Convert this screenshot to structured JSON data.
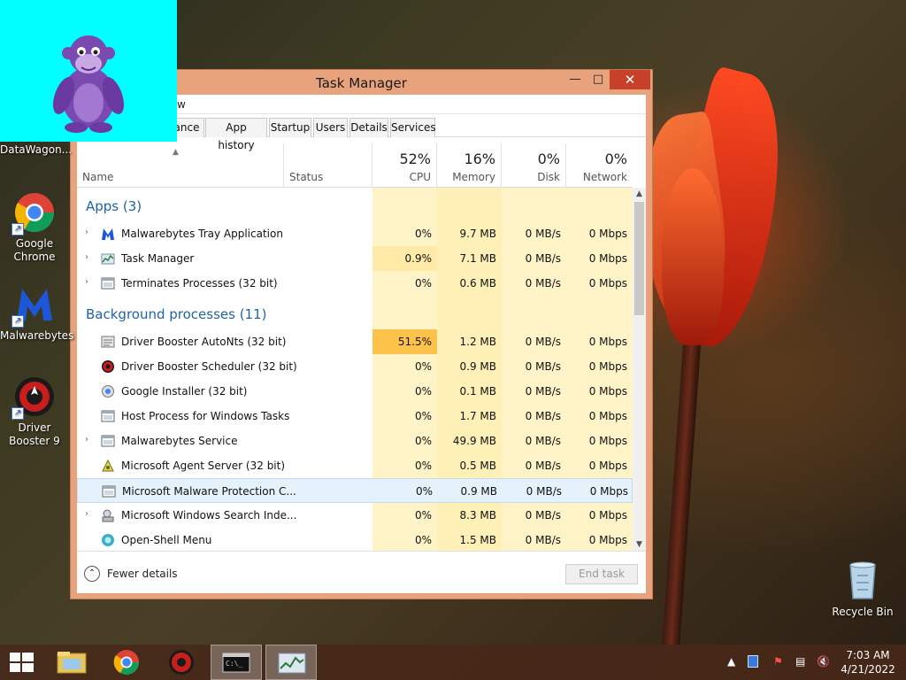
{
  "desktop": {
    "icons": [
      {
        "label": "DataWagon...",
        "icon": "bonzi-icon"
      },
      {
        "label": "Google Chrome",
        "icon": "chrome-icon"
      },
      {
        "label": "Malwarebytes",
        "icon": "malwarebytes-icon"
      },
      {
        "label": "Driver Booster 9",
        "icon": "driver-booster-icon"
      },
      {
        "label": "Recycle Bin",
        "icon": "recycle-bin-icon"
      }
    ]
  },
  "tm": {
    "title": "Task Manager",
    "tabs": [
      "ance",
      "App history",
      "Startup",
      "Users",
      "Details",
      "Services"
    ],
    "columns": {
      "name": "Name",
      "status": "Status",
      "cpu": {
        "pct": "52%",
        "label": "CPU"
      },
      "memory": {
        "pct": "16%",
        "label": "Memory"
      },
      "disk": {
        "pct": "0%",
        "label": "Disk"
      },
      "network": {
        "pct": "0%",
        "label": "Network"
      }
    },
    "groups": [
      "Apps (3)",
      "Background processes (11)"
    ],
    "rows": [
      {
        "name": "Malwarebytes Tray Application",
        "cpu": "0%",
        "memory": "9.7 MB",
        "disk": "0 MB/s",
        "network": "0 Mbps",
        "icon": "malwarebytes-icon",
        "expand": true
      },
      {
        "name": "Task Manager",
        "cpu": "0.9%",
        "memory": "7.1 MB",
        "disk": "0 MB/s",
        "network": "0 Mbps",
        "icon": "task-manager-icon",
        "expand": true
      },
      {
        "name": "Terminates Processes (32 bit)",
        "cpu": "0%",
        "memory": "0.6 MB",
        "disk": "0 MB/s",
        "network": "0 Mbps",
        "icon": "window-icon",
        "expand": true
      },
      {
        "name": "Driver Booster AutoNts (32 bit)",
        "cpu": "51.5%",
        "memory": "1.2 MB",
        "disk": "0 MB/s",
        "network": "0 Mbps",
        "icon": "service-icon",
        "expand": false
      },
      {
        "name": "Driver Booster Scheduler (32 bit)",
        "cpu": "0%",
        "memory": "0.9 MB",
        "disk": "0 MB/s",
        "network": "0 Mbps",
        "icon": "driver-booster-icon",
        "expand": false
      },
      {
        "name": "Google Installer (32 bit)",
        "cpu": "0%",
        "memory": "0.1 MB",
        "disk": "0 MB/s",
        "network": "0 Mbps",
        "icon": "installer-icon",
        "expand": false
      },
      {
        "name": "Host Process for Windows Tasks",
        "cpu": "0%",
        "memory": "1.7 MB",
        "disk": "0 MB/s",
        "network": "0 Mbps",
        "icon": "window-icon",
        "expand": false
      },
      {
        "name": "Malwarebytes Service",
        "cpu": "0%",
        "memory": "49.9 MB",
        "disk": "0 MB/s",
        "network": "0 Mbps",
        "icon": "window-icon",
        "expand": true
      },
      {
        "name": "Microsoft Agent Server (32 bit)",
        "cpu": "0%",
        "memory": "0.5 MB",
        "disk": "0 MB/s",
        "network": "0 Mbps",
        "icon": "agent-icon",
        "expand": false
      },
      {
        "name": "Microsoft Malware Protection C...",
        "cpu": "0%",
        "memory": "0.9 MB",
        "disk": "0 MB/s",
        "network": "0 Mbps",
        "icon": "window-icon",
        "expand": false,
        "selected": true
      },
      {
        "name": "Microsoft Windows Search Inde...",
        "cpu": "0%",
        "memory": "8.3 MB",
        "disk": "0 MB/s",
        "network": "0 Mbps",
        "icon": "search-indexer-icon",
        "expand": true
      },
      {
        "name": "Open-Shell Menu",
        "cpu": "0%",
        "memory": "1.5 MB",
        "disk": "0 MB/s",
        "network": "0 Mbps",
        "icon": "shell-icon",
        "expand": false
      }
    ],
    "fewer_details": "Fewer details",
    "end_task": "End task"
  },
  "taskbar": {
    "clock": {
      "time": "7:03 AM",
      "date": "4/21/2022"
    },
    "items": [
      "start-icon",
      "file-explorer-icon",
      "chrome-icon",
      "driver-booster-icon",
      "cmd-icon",
      "task-manager-icon"
    ]
  },
  "colors": {
    "window_frame": "#e8a27c",
    "close_button": "#c7402a",
    "group_heading": "#1e64a8",
    "cpu_hot": "#fdc24a",
    "heat_light": "#fff4c8",
    "bonzi_bg": "#00ffff"
  }
}
